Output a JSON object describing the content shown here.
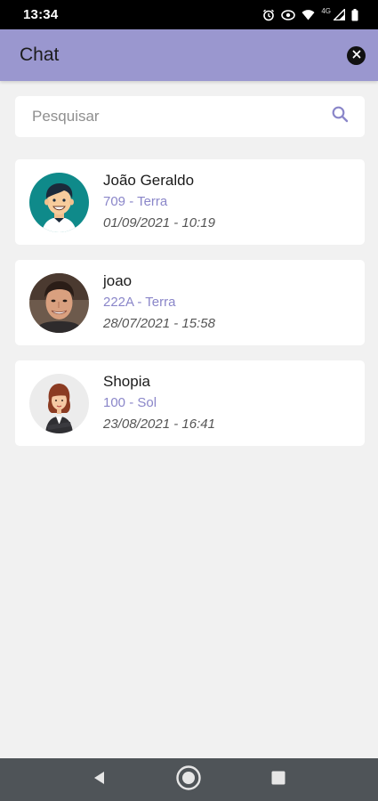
{
  "status_bar": {
    "time": "13:34",
    "network_label": "4G",
    "icons": [
      "alarm-icon",
      "data-saver-icon",
      "wifi-icon",
      "signal-icon",
      "battery-icon"
    ]
  },
  "app_bar": {
    "title": "Chat",
    "close_icon": "close-icon",
    "background": "#9a97cf"
  },
  "search": {
    "placeholder": "Pesquisar",
    "value": "",
    "icon": "search-icon"
  },
  "chats": [
    {
      "name": "João Geraldo",
      "subtitle": "709 - Terra",
      "date": "01/09/2021 - 10:19",
      "avatar": "cartoon-boy-avatar"
    },
    {
      "name": "joao",
      "subtitle": "222A - Terra",
      "date": "28/07/2021 - 15:58",
      "avatar": "man-photo-avatar"
    },
    {
      "name": "Shopia",
      "subtitle": "100 - Sol",
      "date": "23/08/2021 - 16:41",
      "avatar": "cartoon-woman-avatar"
    }
  ],
  "nav_bar": {
    "items": [
      "back-icon",
      "home-icon",
      "recents-icon"
    ]
  },
  "colors": {
    "accent": "#8a86c9",
    "background": "#f1f1f1"
  }
}
